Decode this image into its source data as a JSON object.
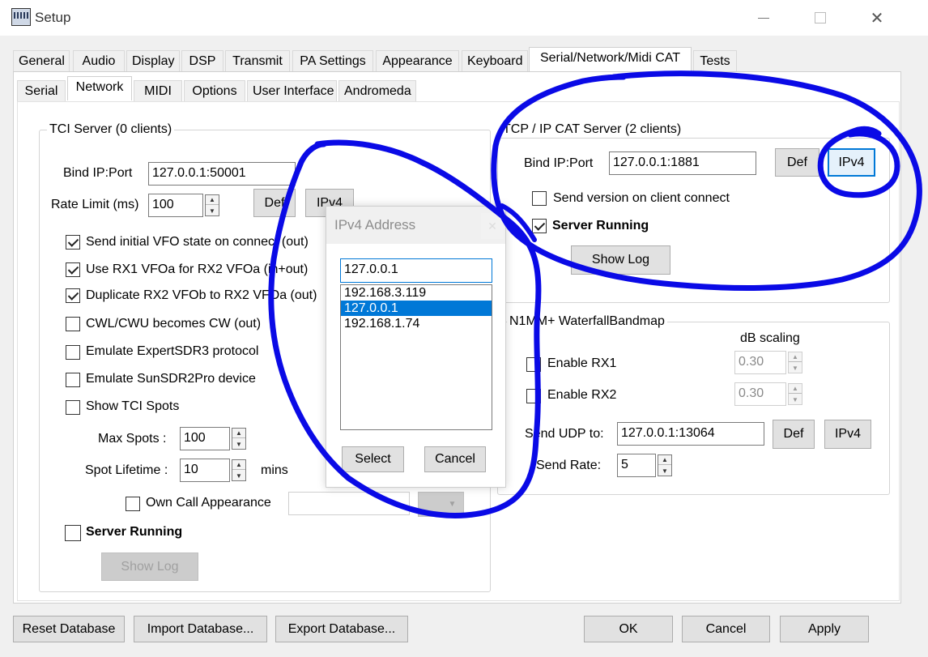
{
  "window": {
    "title": "Setup"
  },
  "main_tabs": [
    "General",
    "Audio",
    "Display",
    "DSP",
    "Transmit",
    "PA Settings",
    "Appearance",
    "Keyboard",
    "Serial/Network/Midi CAT",
    "Tests"
  ],
  "sub_tabs": [
    "Serial",
    "Network",
    "MIDI",
    "Options",
    "User Interface",
    "Andromeda"
  ],
  "tci": {
    "title": "TCI Server (0 clients)",
    "bind_label": "Bind IP:Port",
    "bind_value": "127.0.0.1:50001",
    "rate_label": "Rate Limit (ms)",
    "rate_value": "100",
    "def_label": "Def",
    "ipv4_label": "IPv4",
    "options": [
      {
        "label": "Send initial VFO state on connect (out)",
        "checked": true
      },
      {
        "label": "Use RX1 VFOa for RX2 VFOa (in+out)",
        "checked": true
      },
      {
        "label": "Duplicate RX2 VFOb to RX2 VFOa (out)",
        "checked": true
      },
      {
        "label": "CWL/CWU becomes CW (out)",
        "checked": false
      },
      {
        "label": "Emulate ExpertSDR3 protocol",
        "checked": false
      },
      {
        "label": "Emulate SunSDR2Pro device",
        "checked": false
      },
      {
        "label": "Show TCI Spots",
        "checked": false
      }
    ],
    "max_spots_label": "Max Spots :",
    "max_spots_value": "100",
    "spot_lifetime_label": "Spot Lifetime :",
    "spot_lifetime_value": "10",
    "mins_label": "mins",
    "own_call_label": "Own Call Appearance",
    "server_running_label": "Server Running",
    "show_log_label": "Show Log"
  },
  "tcpip": {
    "title": "TCP / IP CAT Server (2 clients)",
    "bind_label": "Bind IP:Port",
    "bind_value": "127.0.0.1:1881",
    "def_label": "Def",
    "ipv4_label": "IPv4",
    "send_version_label": "Send version on client connect",
    "server_running_label": "Server Running",
    "show_log_label": "Show Log"
  },
  "n1mm": {
    "title": "N1MM+ WaterfallBandmap",
    "db_scaling_label": "dB scaling",
    "enable_rx1_label": "Enable RX1",
    "enable_rx2_label": "Enable RX2",
    "rx1_db": "0.30",
    "rx2_db": "0.30",
    "udp_label": "Send UDP to:",
    "udp_value": "127.0.0.1:13064",
    "def_label": "Def",
    "ipv4_label": "IPv4",
    "send_rate_label": "Send Rate:",
    "send_rate_value": "5"
  },
  "dialog": {
    "title": "IPv4 Address",
    "input_value": "127.0.0.1",
    "addresses": [
      "192.168.3.119",
      "127.0.0.1",
      "192.168.1.74"
    ],
    "selected_index": 1,
    "select_label": "Select",
    "cancel_label": "Cancel"
  },
  "bottom": {
    "reset_label": "Reset Database",
    "import_label": "Import Database...",
    "export_label": "Export Database...",
    "ok_label": "OK",
    "cancel_label": "Cancel",
    "apply_label": "Apply"
  },
  "colors": {
    "annotation": "#0a0ae6",
    "selection": "#0078d7",
    "focus": "#0078d7"
  }
}
